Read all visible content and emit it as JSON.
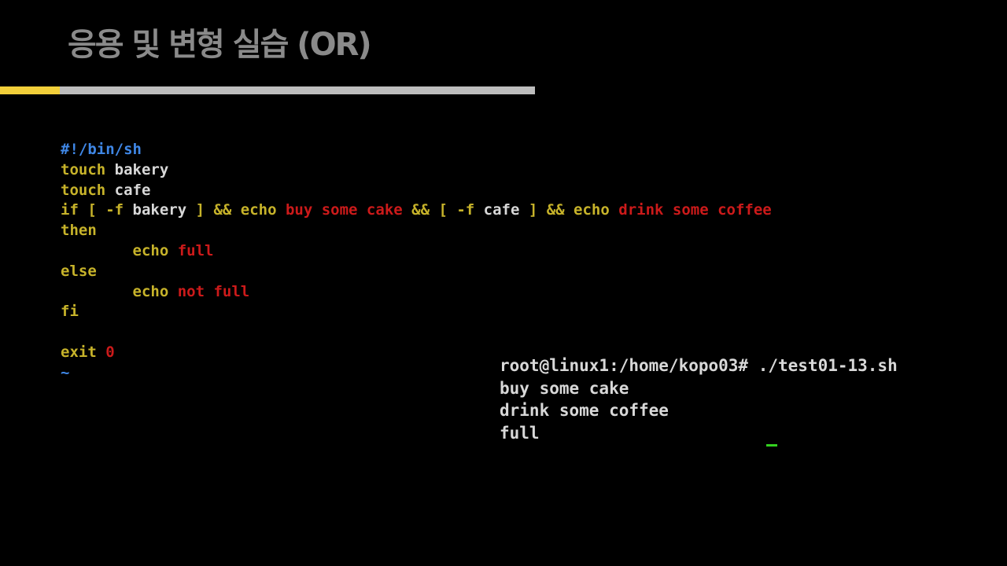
{
  "title": "응용 및 변형 실습 (OR)",
  "colors": {
    "accent": "#f2cf3a",
    "keyword": "#c7b32a",
    "plain": "#d8d8d8",
    "string": "#cc1a1a",
    "comment": "#3f87e6",
    "cursor": "#33d11f"
  },
  "code_lines": [
    [
      {
        "t": "#!/bin/sh",
        "c": "comment"
      }
    ],
    [
      {
        "t": "touch",
        "c": "keyword"
      },
      {
        "t": " bakery",
        "c": "plain"
      }
    ],
    [
      {
        "t": "touch",
        "c": "keyword"
      },
      {
        "t": " cafe",
        "c": "plain"
      }
    ],
    [
      {
        "t": "if [ -f",
        "c": "keyword"
      },
      {
        "t": " bakery ",
        "c": "plain"
      },
      {
        "t": "] && echo ",
        "c": "keyword"
      },
      {
        "t": "buy some cake ",
        "c": "string"
      },
      {
        "t": "&& [ -f ",
        "c": "keyword"
      },
      {
        "t": "cafe ",
        "c": "plain"
      },
      {
        "t": "] && echo ",
        "c": "keyword"
      },
      {
        "t": "drink some coffee",
        "c": "string"
      }
    ],
    [
      {
        "t": "then",
        "c": "keyword"
      }
    ],
    [
      {
        "t": "        echo ",
        "c": "keyword"
      },
      {
        "t": "full",
        "c": "string"
      }
    ],
    [
      {
        "t": "else",
        "c": "keyword"
      }
    ],
    [
      {
        "t": "        echo ",
        "c": "keyword"
      },
      {
        "t": "not full",
        "c": "string"
      }
    ],
    [
      {
        "t": "fi",
        "c": "keyword"
      }
    ],
    [
      {
        "t": "",
        "c": "plain"
      }
    ],
    [
      {
        "t": "exit ",
        "c": "keyword"
      },
      {
        "t": "0",
        "c": "string"
      }
    ],
    [
      {
        "t": "~",
        "c": "comment"
      }
    ]
  ],
  "terminal_lines": [
    "root@linux1:/home/kopo03# ./test01-13.sh",
    "buy some cake",
    "drink some coffee",
    "full"
  ]
}
